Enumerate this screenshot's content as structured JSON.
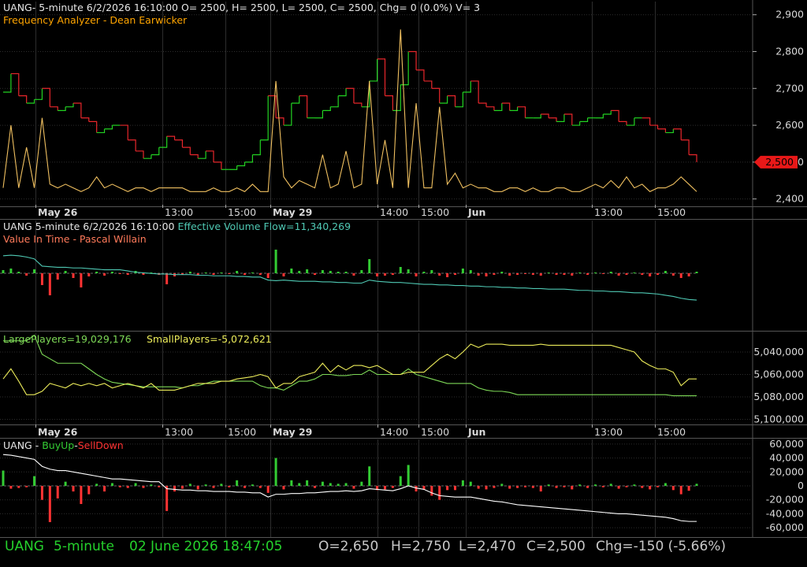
{
  "colors": {
    "background": "#000000",
    "grid": "#2d2d2d",
    "axis_text": "#d8d8d8",
    "title_text": "#e6e6e6",
    "indicator_title": "#ffa500",
    "price_up": "#22d322",
    "price_down": "#e8262b",
    "freq_line": "#f0c060",
    "flow_line": "#4fc9b4",
    "value_line": "#ff7a5a",
    "large_players": "#7ed957",
    "small_players": "#ecec5a",
    "buyup": "#33cc33",
    "selldown": "#ff3333",
    "status_green": "#25d12c",
    "status_grey": "#c8c8c8",
    "marker_red": "#e81818"
  },
  "panel1": {
    "title": "UANG- 5-minute 6/2/2026 16:10:00 O= 2500, H= 2500, L= 2500, C= 2500, Chg= 0 (0.0%) V= 3",
    "subtitle": "Frequency Analyzer - Dean Earwicker",
    "last_price": "2,500"
  },
  "panel2": {
    "title_prefix": "UANG 5-minute  6/2/2026 16:10:00",
    "flow_label": "Effective Volume Flow=11,340,269",
    "value_label": "Value In Time - Pascal Willain"
  },
  "panel3": {
    "large_label": "LargePlayers=19,029,176",
    "small_label": "SmallPlayers=-5,072,621"
  },
  "panel4": {
    "label_sym": "UANG - ",
    "label_buy": "BuyUp",
    "label_dash": "-",
    "label_sell": "SellDown"
  },
  "time_axis": {
    "labels": [
      {
        "text": "May 26",
        "bold": true
      },
      {
        "text": "13:00",
        "bold": false
      },
      {
        "text": "15:00",
        "bold": false
      },
      {
        "text": "May 29",
        "bold": true
      },
      {
        "text": "14:00",
        "bold": false
      },
      {
        "text": "15:00",
        "bold": false
      },
      {
        "text": "Jun",
        "bold": true
      },
      {
        "text": "13:00",
        "bold": false
      },
      {
        "text": "15:00",
        "bold": false
      }
    ]
  },
  "status_bar": {
    "symbol": "UANG",
    "interval": "5-minute",
    "datetime": "02 June 2026 18:47:05",
    "open": "O=2,650",
    "high": "H=2,750",
    "low": "L=2,470",
    "close": "C=2,500",
    "change": "Chg=-150 (-5.66%)"
  },
  "chart_data": [
    {
      "type": "line",
      "title": "UANG- 5-minute 6/2/2026 16:10:00 O= 2500, H= 2500, L= 2500, C= 2500, Chg= 0 (0.0%) V= 3",
      "y_ticks": [
        "2,900",
        "2,800",
        "2,700",
        "2,600",
        "2,500",
        "2,400"
      ],
      "ylim": [
        2380,
        2940
      ],
      "series": [
        {
          "name": "price",
          "values": [
            2690,
            2740,
            2680,
            2660,
            2670,
            2700,
            2650,
            2640,
            2650,
            2660,
            2620,
            2610,
            2580,
            2590,
            2600,
            2600,
            2560,
            2530,
            2510,
            2520,
            2540,
            2570,
            2560,
            2540,
            2520,
            2510,
            2530,
            2500,
            2480,
            2480,
            2490,
            2500,
            2520,
            2560,
            2680,
            2620,
            2600,
            2660,
            2680,
            2620,
            2620,
            2640,
            2650,
            2680,
            2700,
            2660,
            2650,
            2720,
            2780,
            2680,
            2640,
            2710,
            2800,
            2750,
            2720,
            2700,
            2660,
            2680,
            2650,
            2690,
            2720,
            2660,
            2650,
            2640,
            2660,
            2640,
            2650,
            2620,
            2620,
            2630,
            2620,
            2610,
            2630,
            2600,
            2610,
            2620,
            2620,
            2630,
            2640,
            2610,
            2600,
            2620,
            2620,
            2600,
            2590,
            2580,
            2590,
            2560,
            2520,
            2500
          ]
        },
        {
          "name": "Frequency Analyzer",
          "values": [
            2430,
            2600,
            2430,
            2540,
            2430,
            2620,
            2440,
            2430,
            2440,
            2430,
            2420,
            2430,
            2460,
            2430,
            2440,
            2430,
            2420,
            2430,
            2430,
            2420,
            2430,
            2430,
            2430,
            2430,
            2420,
            2420,
            2420,
            2430,
            2420,
            2420,
            2430,
            2420,
            2440,
            2420,
            2420,
            2720,
            2460,
            2430,
            2450,
            2440,
            2430,
            2520,
            2430,
            2440,
            2530,
            2430,
            2440,
            2720,
            2440,
            2560,
            2430,
            2860,
            2430,
            2660,
            2430,
            2430,
            2650,
            2440,
            2470,
            2430,
            2440,
            2430,
            2430,
            2420,
            2420,
            2430,
            2430,
            2420,
            2430,
            2420,
            2420,
            2430,
            2430,
            2420,
            2420,
            2430,
            2440,
            2430,
            2450,
            2430,
            2460,
            2430,
            2440,
            2420,
            2430,
            2430,
            2440,
            2460,
            2440,
            2420
          ]
        }
      ]
    },
    {
      "type": "bar",
      "title": "Effective Volume Flow / Value In Time",
      "series": [
        {
          "name": "Effective Volume Flow",
          "values": [
            95,
            96,
            95,
            93,
            90,
            78,
            77,
            76,
            76,
            75,
            75,
            74,
            73,
            72,
            72,
            72,
            70,
            68,
            67,
            66,
            65,
            65,
            64,
            64,
            64,
            63,
            63,
            62,
            62,
            62,
            61,
            61,
            60,
            60,
            55,
            54,
            55,
            54,
            53,
            53,
            53,
            52,
            52,
            51,
            51,
            50,
            50,
            55,
            53,
            52,
            51,
            51,
            50,
            49,
            48,
            48,
            47,
            47,
            46,
            46,
            45,
            45,
            44,
            44,
            43,
            43,
            42,
            42,
            41,
            41,
            40,
            40,
            40,
            39,
            38,
            38,
            37,
            37,
            36,
            36,
            35,
            34,
            34,
            33,
            32,
            30,
            28,
            25,
            23,
            22
          ]
        },
        {
          "name": "Value In Time",
          "values": [
            4,
            6,
            2,
            -3,
            5,
            -15,
            -28,
            -8,
            3,
            -6,
            -18,
            -4,
            2,
            -3,
            2,
            -1,
            -2,
            3,
            -2,
            1,
            -2,
            -14,
            -4,
            -2,
            2,
            -3,
            1,
            -2,
            1,
            -1,
            3,
            -2,
            1,
            -2,
            -6,
            30,
            -4,
            6,
            3,
            5,
            -2,
            4,
            3,
            2,
            2,
            -3,
            4,
            18,
            -4,
            -3,
            -2,
            8,
            5,
            -4,
            2,
            4,
            -3,
            -5,
            -2,
            6,
            4,
            -3,
            -4,
            -2,
            2,
            -3,
            -2,
            -1,
            -2,
            -3,
            1,
            -2,
            -2,
            -3,
            1,
            -2,
            1,
            -1,
            2,
            -3,
            -2,
            1,
            -2,
            -4,
            -2,
            3,
            -3,
            -6,
            -4,
            2
          ]
        }
      ]
    },
    {
      "type": "line",
      "title": "LargePlayers / SmallPlayers",
      "y_ticks": [
        "5,040,000",
        "5,060,000",
        "5,080,000",
        "5,100,000"
      ],
      "series": [
        {
          "name": "LargePlayers",
          "values": [
            5030000,
            5030000,
            5030000,
            5030000,
            5025000,
            5042000,
            5046000,
            5050000,
            5050000,
            5050000,
            5050000,
            5055000,
            5060000,
            5064000,
            5067000,
            5068000,
            5069000,
            5070000,
            5071000,
            5071000,
            5071000,
            5071000,
            5071000,
            5072000,
            5070000,
            5070000,
            5068000,
            5066000,
            5066000,
            5066000,
            5066000,
            5066000,
            5066000,
            5070000,
            5072000,
            5072000,
            5074000,
            5070000,
            5066000,
            5066000,
            5064000,
            5060000,
            5060000,
            5061000,
            5061000,
            5060000,
            5060000,
            5056000,
            5060000,
            5060000,
            5060000,
            5060000,
            5055000,
            5060000,
            5062000,
            5064000,
            5066000,
            5068000,
            5068000,
            5068000,
            5068000,
            5072000,
            5074000,
            5075000,
            5075000,
            5076000,
            5078000,
            5078000,
            5078000,
            5078000,
            5078000,
            5078000,
            5078000,
            5078000,
            5078000,
            5078000,
            5078000,
            5078000,
            5078000,
            5078000,
            5078000,
            5078000,
            5078000,
            5078000,
            5078000,
            5078000,
            5079000,
            5079000,
            5079000,
            5079000
          ]
        },
        {
          "name": "SmallPlayers",
          "values": [
            5064000,
            5055000,
            5066000,
            5078000,
            5078000,
            5075000,
            5068000,
            5070000,
            5072000,
            5068000,
            5070000,
            5068000,
            5070000,
            5068000,
            5072000,
            5070000,
            5068000,
            5070000,
            5072000,
            5068000,
            5074000,
            5074000,
            5074000,
            5072000,
            5070000,
            5068000,
            5068000,
            5068000,
            5066000,
            5066000,
            5064000,
            5063000,
            5062000,
            5060000,
            5062000,
            5072000,
            5068000,
            5068000,
            5062000,
            5060000,
            5058000,
            5050000,
            5058000,
            5052000,
            5056000,
            5052000,
            5052000,
            5054000,
            5052000,
            5056000,
            5060000,
            5060000,
            5058000,
            5058000,
            5058000,
            5052000,
            5046000,
            5042000,
            5046000,
            5040000,
            5033000,
            5036000,
            5033000,
            5033000,
            5033000,
            5034000,
            5034000,
            5034000,
            5034000,
            5033000,
            5034000,
            5034000,
            5034000,
            5034000,
            5034000,
            5034000,
            5034000,
            5034000,
            5034000,
            5036000,
            5038000,
            5040000,
            5048000,
            5052000,
            5055000,
            5055000,
            5058000,
            5070000,
            5064000,
            5064000
          ]
        }
      ]
    },
    {
      "type": "bar",
      "title": "UANG - BuyUp-SellDown",
      "y_ticks": [
        "60,000",
        "40,000",
        "20,000",
        "0",
        "-20,000",
        "-40,000",
        "-60,000"
      ],
      "ylim": [
        -70000,
        70000
      ],
      "series": [
        {
          "name": "BuyUp-SellDown",
          "values": [
            22000,
            -4000,
            -3000,
            -2000,
            14000,
            -20000,
            -52000,
            -18000,
            6000,
            -8000,
            -26000,
            -12000,
            3000,
            -8000,
            4000,
            -2000,
            -3000,
            4000,
            -3000,
            2000,
            -2000,
            -36000,
            -8000,
            -4000,
            3000,
            -5000,
            2000,
            -3000,
            3000,
            -2000,
            8000,
            -3000,
            2000,
            -3000,
            -10000,
            40000,
            -5000,
            8000,
            4000,
            8000,
            -3000,
            6000,
            4000,
            3000,
            4000,
            -4000,
            6000,
            28000,
            -6000,
            -5000,
            -3000,
            14000,
            30000,
            -8000,
            -5000,
            -14000,
            -20000,
            -6000,
            -6000,
            8000,
            6000,
            -4000,
            -5000,
            -3000,
            3000,
            -4000,
            -3000,
            -2000,
            -3000,
            -8000,
            2000,
            -3000,
            -2000,
            -5000,
            2000,
            -3000,
            2000,
            -2000,
            3000,
            -4000,
            -2000,
            2000,
            -3000,
            -5000,
            -2000,
            4000,
            -6000,
            -12000,
            -7000,
            3000
          ]
        },
        {
          "name": "cumulative",
          "values": [
            45000,
            44000,
            42000,
            40000,
            38000,
            28000,
            24000,
            22000,
            22000,
            20000,
            18000,
            16000,
            14000,
            12000,
            10000,
            10000,
            9000,
            8000,
            7000,
            6000,
            6000,
            -4000,
            -5000,
            -6000,
            -6000,
            -7000,
            -7000,
            -8000,
            -8000,
            -8000,
            -9000,
            -9000,
            -10000,
            -10000,
            -16000,
            -12000,
            -12000,
            -11000,
            -11000,
            -10000,
            -10000,
            -9000,
            -8000,
            -8000,
            -7000,
            -8000,
            -7000,
            -4000,
            -5000,
            -6000,
            -7000,
            -4000,
            0,
            -3000,
            -5000,
            -10000,
            -14000,
            -15000,
            -16000,
            -16000,
            -16000,
            -18000,
            -20000,
            -22000,
            -23000,
            -25000,
            -27000,
            -28000,
            -29000,
            -30000,
            -31000,
            -32000,
            -33000,
            -34000,
            -35000,
            -36000,
            -37000,
            -38000,
            -39000,
            -40000,
            -40000,
            -41000,
            -42000,
            -43000,
            -44000,
            -45000,
            -47000,
            -50000,
            -51000,
            -51000
          ]
        }
      ]
    }
  ]
}
